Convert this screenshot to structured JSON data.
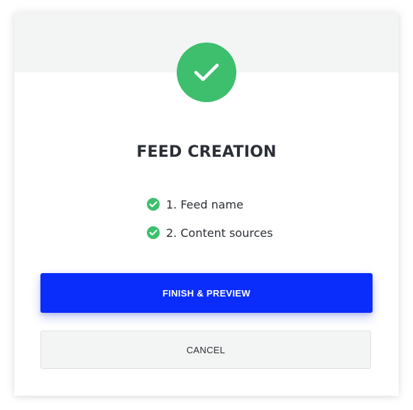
{
  "dialog": {
    "title": "FEED CREATION",
    "header_icon": "check-icon",
    "steps": [
      {
        "label": "1. Feed name",
        "icon": "check-circle-icon",
        "status": "complete"
      },
      {
        "label": "2. Content sources",
        "icon": "check-circle-icon",
        "status": "complete"
      }
    ],
    "primary_button": "FINISH & PREVIEW",
    "secondary_button": "CANCEL"
  },
  "colors": {
    "success": "#3dbf6e",
    "primary": "#0a2dfc",
    "header_bg": "#f3f4f4",
    "text": "#2b2f36"
  }
}
